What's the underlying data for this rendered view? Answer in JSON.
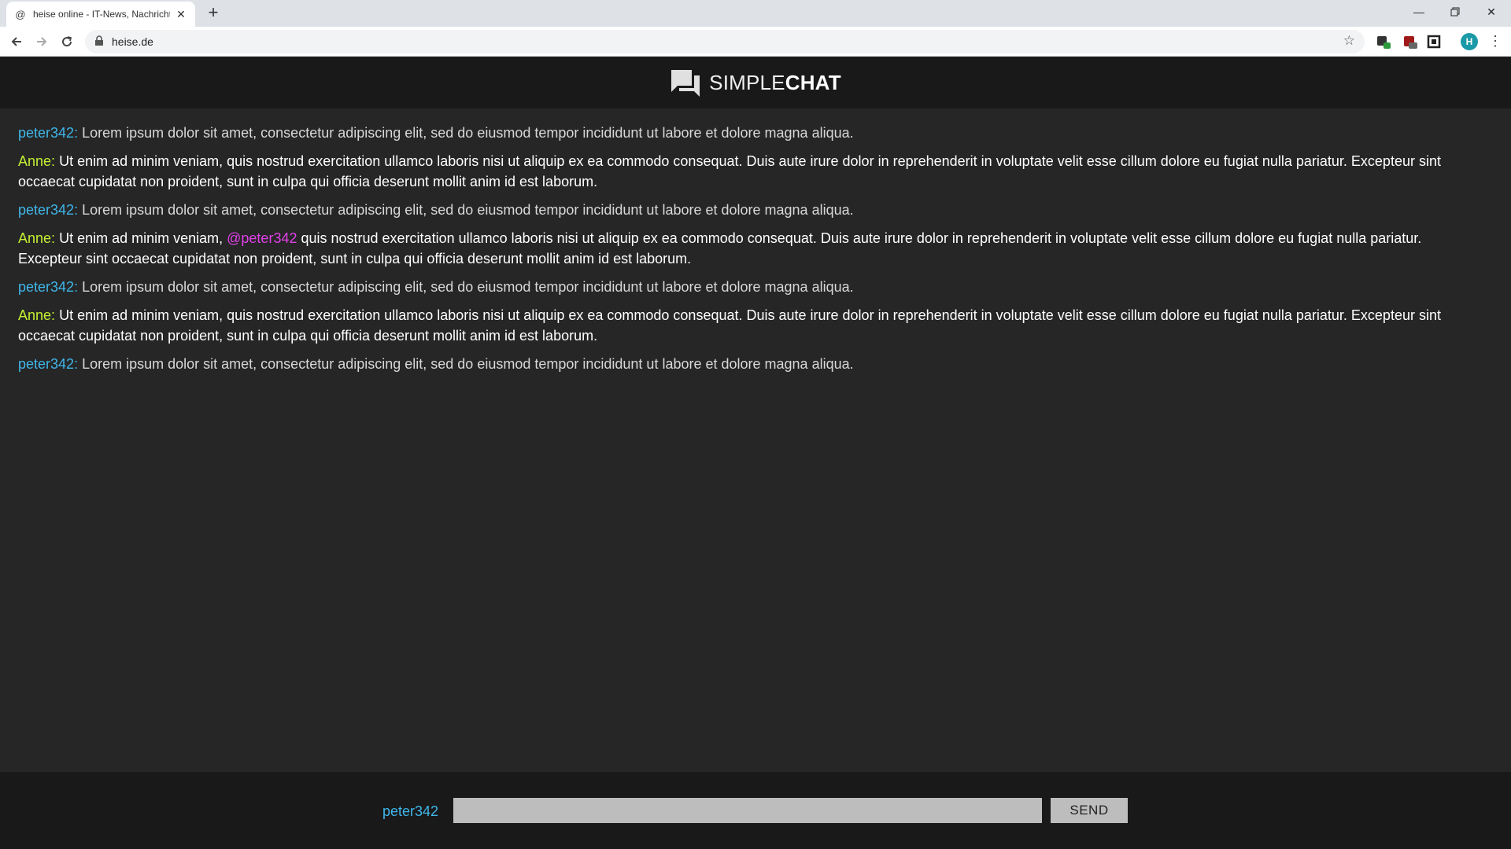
{
  "browser": {
    "tab_title": "heise online - IT-News, Nachrichten",
    "tab_favicon": "@",
    "url": "heise.de"
  },
  "app": {
    "logo_light": "SIMPLE",
    "logo_bold": "CHAT"
  },
  "messages": [
    {
      "user": "peter342",
      "sep": ":",
      "text": " Lorem ipsum dolor sit amet, consectetur adipiscing elit, sed do eiusmod tempor incididunt ut labore et dolore magna aliqua."
    },
    {
      "user": "Anne",
      "sep": ":",
      "text": " Ut enim ad minim veniam, quis nostrud exercitation ullamco laboris nisi ut aliquip ex ea commodo consequat. Duis aute irure dolor in reprehenderit in voluptate velit esse cillum dolore eu fugiat nulla pariatur. Excepteur sint occaecat cupidatat non proident, sunt in culpa qui officia deserunt mollit anim id est laborum."
    },
    {
      "user": "peter342",
      "sep": ":",
      "text": " Lorem ipsum dolor sit amet, consectetur adipiscing elit, sed do eiusmod tempor incididunt ut labore et dolore magna aliqua."
    },
    {
      "user": "Anne",
      "sep": ":",
      "text_before": " Ut enim ad minim veniam, ",
      "mention": "@peter342",
      "text_after": " quis nostrud exercitation ullamco laboris nisi ut aliquip ex ea commodo consequat. Duis aute irure dolor in reprehenderit in voluptate velit esse cillum dolore eu fugiat nulla pariatur. Excepteur sint occaecat cupidatat non proident, sunt in culpa qui officia deserunt mollit anim id est laborum."
    },
    {
      "user": "peter342",
      "sep": ":",
      "text": " Lorem ipsum dolor sit amet, consectetur adipiscing elit, sed do eiusmod tempor incididunt ut labore et dolore magna aliqua."
    },
    {
      "user": "Anne",
      "sep": ":",
      "text": " Ut enim ad minim veniam, quis nostrud exercitation ullamco laboris nisi ut aliquip ex ea commodo consequat. Duis aute irure dolor in reprehenderit in voluptate velit esse cillum dolore eu fugiat nulla pariatur. Excepteur sint occaecat cupidatat non proident, sunt in culpa qui officia deserunt mollit anim id est laborum."
    },
    {
      "user": "peter342",
      "sep": ":",
      "text": " Lorem ipsum dolor sit amet, consectetur adipiscing elit, sed do eiusmod tempor incididunt ut labore et dolore magna aliqua."
    }
  ],
  "composer": {
    "current_user": "peter342",
    "input_value": "",
    "send_label": "SEND"
  },
  "colors": {
    "user_peter": "#3fb7ea",
    "user_anne": "#c4f032",
    "mention": "#e040e8",
    "background": "#262626",
    "header": "#191919"
  },
  "icons": [
    "back-arrow-icon",
    "forward-arrow-icon",
    "reload-icon",
    "lock-icon",
    "star-icon",
    "chat-bubbles-icon"
  ]
}
